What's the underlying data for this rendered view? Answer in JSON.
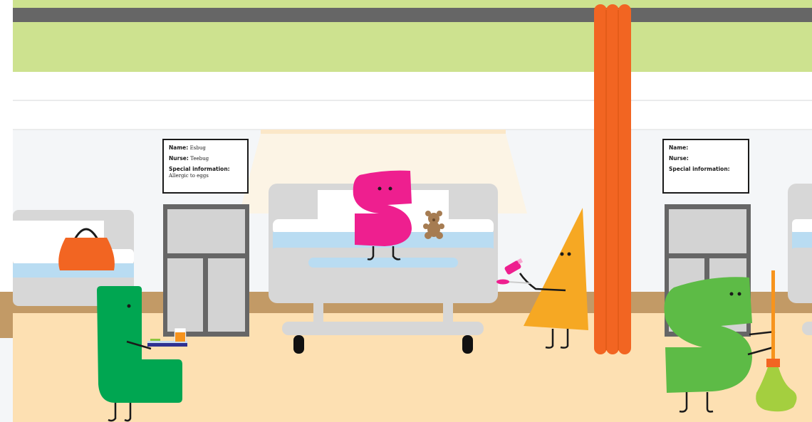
{
  "scene": "hospital-ward",
  "palette": {
    "wall": "#f4f6f8",
    "window_green": "#cde28f",
    "rail": "#666666",
    "floor": "#fde0b2",
    "skirting": "#c29a66",
    "bed_grey": "#d7d7d7",
    "sheet_blue": "#b9dcf2",
    "curtain": "#f26522",
    "cabinet_frame": "#666666",
    "char_pink": "#ee1f8f",
    "char_green_dark": "#00a651",
    "char_green_light": "#5dbb46",
    "char_orange": "#f6a823",
    "bag_orange": "#f26522"
  },
  "info_cards": [
    {
      "name_label": "Name:",
      "name_value": "Esbug",
      "nurse_label": "Nurse:",
      "nurse_value": "Teebug",
      "special_label": "Special information:",
      "special_value": "Allergic to eggs"
    },
    {
      "name_label": "Name:",
      "name_value": "",
      "nurse_label": "Nurse:",
      "nurse_value": "",
      "special_label": "Special information:",
      "special_value": ""
    }
  ],
  "characters": [
    {
      "id": "l-shaped",
      "role": "carrying-tray-with-drink",
      "color": "char_green_dark"
    },
    {
      "id": "s-shaped-patient",
      "role": "sitting-in-bed-with-teddy",
      "color": "char_pink"
    },
    {
      "id": "t-shaped-nurse",
      "role": "giving-medicine-on-spoon",
      "color": "char_orange"
    },
    {
      "id": "s-shaped-cleaner",
      "role": "sweeping-with-broom",
      "color": "char_green_light"
    }
  ]
}
